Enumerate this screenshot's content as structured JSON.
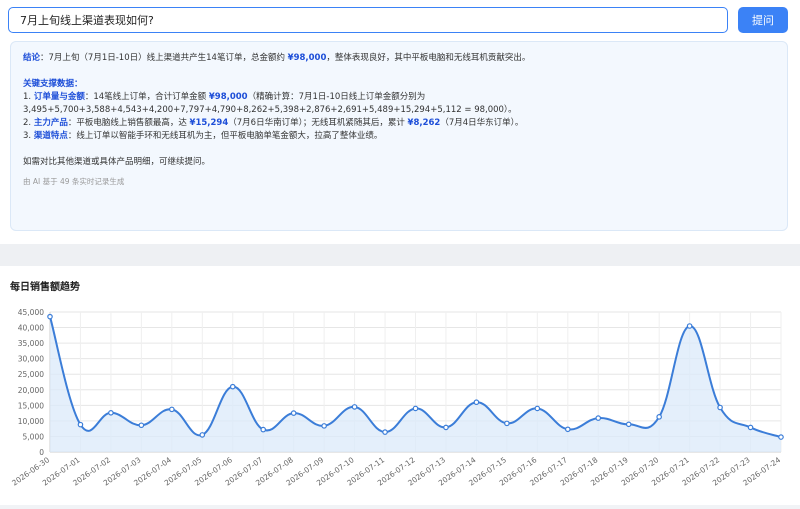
{
  "search": {
    "value": "7月上旬线上渠道表现如何?",
    "button_label": "提问"
  },
  "answer": {
    "conclusion_label": "结论",
    "conclusion_pre": "：7月上旬（7月1日-10日）线上渠道共产生14笔订单，总金额约 ",
    "conclusion_amount": "¥98,000",
    "conclusion_post": "，整体表现良好，其中平板电脑和无线耳机贡献突出。",
    "support_heading": "关键支撑数据：",
    "item1_prefix": "1. ",
    "item1_label": "订单量与金额",
    "item1_pre": "：14笔线上订单，合计订单金额 ",
    "item1_amount": "¥98,000",
    "item1_post": "（精确计算：7月1日-10日线上订单金额分别为",
    "item1_line2": "3,495+5,700+3,588+4,543+4,200+7,797+4,790+8,262+5,398+2,876+2,691+5,489+15,294+5,112 = 98,000）。",
    "item2_prefix": "2. ",
    "item2_label": "主力产品",
    "item2_pre": "：平板电脑线上销售额最高，达 ",
    "item2_amount": "¥15,294",
    "item2_mid": "（7月6日华南订单）；无线耳机紧随其后，累计 ",
    "item2_amount2": "¥8,262",
    "item2_post": "（7月4日华东订单）。",
    "item3_prefix": "3. ",
    "item3_label": "渠道特点",
    "item3_text": "：线上订单以智能手环和无线耳机为主，但平板电脑单笔金额大，拉高了整体业绩。",
    "closing": "如需对比其他渠道或具体产品明细，可继续提问。",
    "ai_note": "由 AI 基于 49 条实时记录生成"
  },
  "chart_title": "每日销售额趋势",
  "colors": {
    "accent": "#3b82f6",
    "line": "#3b7dd8",
    "area": "#dbe9f9",
    "highlight_text": "#1d4ed8"
  },
  "chart_data": {
    "type": "area",
    "title": "每日销售额趋势",
    "xlabel": "",
    "ylabel": "",
    "ylim": [
      0,
      45000
    ],
    "yticks": [
      "0",
      "5,000",
      "10,000",
      "15,000",
      "20,000",
      "25,000",
      "30,000",
      "35,000",
      "40,000",
      "45,000"
    ],
    "grid": true,
    "categories": [
      "2026-06-30",
      "2026-07-01",
      "2026-07-02",
      "2026-07-03",
      "2026-07-04",
      "2026-07-05",
      "2026-07-06",
      "2026-07-07",
      "2026-07-08",
      "2026-07-09",
      "2026-07-10",
      "2026-07-11",
      "2026-07-12",
      "2026-07-13",
      "2026-07-14",
      "2026-07-15",
      "2026-07-16",
      "2026-07-17",
      "2026-07-18",
      "2026-07-19",
      "2026-07-20",
      "2026-07-21",
      "2026-07-22",
      "2026-07-23",
      "2026-07-24"
    ],
    "values": [
      43500,
      8800,
      12600,
      8600,
      13700,
      5500,
      21000,
      7200,
      12500,
      8400,
      14500,
      6400,
      14000,
      7900,
      16000,
      9200,
      14000,
      7300,
      10900,
      8900,
      11300,
      40500,
      14300,
      7900,
      4800
    ]
  }
}
